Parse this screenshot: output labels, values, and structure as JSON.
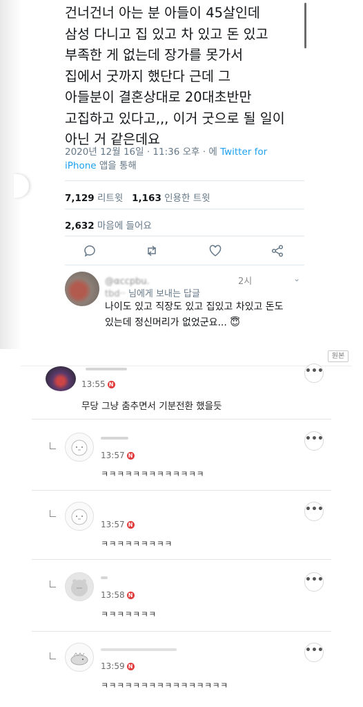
{
  "tweet": {
    "lines": [
      "건너건너 아는 분 아들이 45살인데",
      "삼성 다니고 집 있고 차 있고 돈 있고",
      "부족한 게 없는데 장가를 못가서",
      "집에서 굿까지 했단다 근데 그",
      "아들분이 결혼상대로 20대초반만",
      "고집하고 있다고,,, 이거 굿으로 될 일이",
      "아닌 거 같은데요"
    ],
    "meta_line1_prefix": "2020년 12월 16일 · 11:36 오후 · 에 ",
    "meta_link1": "Twitter for",
    "meta_link2": "iPhone",
    "meta_line2_suffix": " 앱을 통해",
    "retweets_count": "7,129",
    "retweets_label": "리트윗",
    "quotes_count": "1,163",
    "quotes_label": "인용한 트윗",
    "likes_count": "2,632",
    "likes_label": "마음에 들어요",
    "actions": [
      "reply-icon",
      "retweet-icon",
      "heart-icon",
      "share-icon"
    ]
  },
  "reply": {
    "handle_fragment": "@αccpbu.",
    "time_fragment": "2시",
    "to_fragment": "tbd··",
    "to_label": "님에게 보내는 답글",
    "body_line1": "나이도 있고 직장도 있고 집있고 차있고 돈도",
    "body_line2": "있는데 정신머리가 없었군요... 😇"
  },
  "source_badge": "원본",
  "comments": [
    {
      "time": "13:55",
      "badge": "N",
      "text": "무당 그냥 춤추면서 기분전환 했을듯",
      "is_reply": false
    },
    {
      "time": "13:57",
      "badge": "N",
      "text": "ㅋㅋㅋㅋㅋㅋㅋㅋㅋㅋㅋㅋㅋ",
      "is_reply": true
    },
    {
      "time": "13:57",
      "badge": "N",
      "text": "ㅋㅋㅋㅋㅋㅋㅋㅋㅋ",
      "is_reply": true
    },
    {
      "time": "13:58",
      "badge": "N",
      "text": "ㅋㅋㅋㅋㅋㅋㅋ",
      "is_reply": true
    },
    {
      "time": "13:59",
      "badge": "N",
      "text": "ㅋㅋㅋㅋㅋㅋㅋㅋㅋㅋㅋㅋㅋㅋㅋㅋ",
      "is_reply": true
    }
  ],
  "more_label": "•••",
  "colors": {
    "twitter_blue": "#1da1f2",
    "muted": "#657786",
    "new_badge": "#e23b3b"
  }
}
